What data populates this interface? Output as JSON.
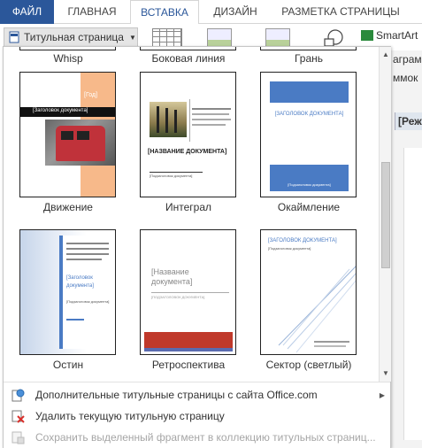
{
  "ribbon": {
    "tabs": [
      "ФАЙЛ",
      "ГЛАВНАЯ",
      "ВСТАВКА",
      "ДИЗАЙН",
      "РАЗМЕТКА СТРАНИЦЫ"
    ],
    "cover_button_label": "Титульная страница",
    "smartart_label": "SmartArt"
  },
  "right_side": {
    "item1": "аграмм",
    "item2": "ммок",
    "mode": "[Реж"
  },
  "gallery": {
    "top_row_labels": [
      "Whisp",
      "Боковая линия",
      "Грань"
    ],
    "items": [
      {
        "label": "Движение",
        "year": "[Год]",
        "title": "[Заголовок документа]"
      },
      {
        "label": "Интеграл",
        "title": "[НАЗВАНИЕ ДОКУМЕНТА]",
        "subtitle": "[Подзаголовок документа]"
      },
      {
        "label": "Окаймление",
        "title": "[ЗАГОЛОВОК ДОКУМЕНТА]",
        "subtitle": "[Подзаголовок документа]"
      },
      {
        "label": "Остин",
        "title": "[Заголовок документа]",
        "subtitle": "[Подзаголовок документа]"
      },
      {
        "label": "Ретроспектива",
        "title": "[Название документа]",
        "subtitle": "[ПОДЗАГОЛОВОК ДОКУМЕНТА]"
      },
      {
        "label": "Сектор (светлый)",
        "title": "[ЗАГОЛОВОК ДОКУМЕНТА]",
        "subtitle": "[Подзаголовок документа]"
      }
    ]
  },
  "menu": {
    "more_online": "Дополнительные титульные страницы с сайта Office.com",
    "remove_current": "Удалить текущую титульную страницу",
    "save_selection": "Сохранить выделенный фрагмент в коллекцию титульных страниц..."
  },
  "colors": {
    "file_tab": "#2b579a",
    "accent_blue": "#4a7bc4",
    "retro_red": "#c0392b",
    "motion_orange": "#f7b98a"
  }
}
